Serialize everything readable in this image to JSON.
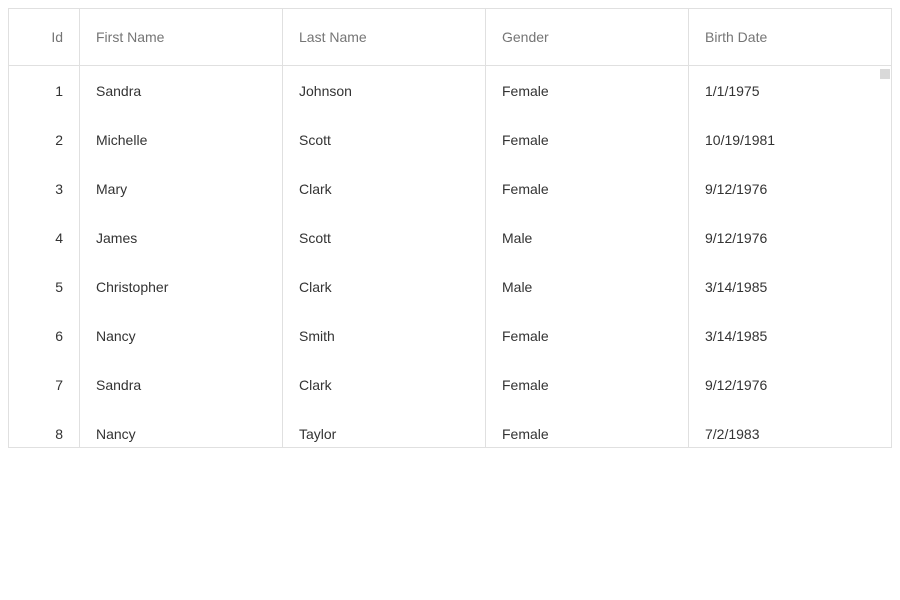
{
  "columns": {
    "id": "Id",
    "first_name": "First Name",
    "last_name": "Last Name",
    "gender": "Gender",
    "birth_date": "Birth Date"
  },
  "rows": [
    {
      "id": "1",
      "first_name": "Sandra",
      "last_name": "Johnson",
      "gender": "Female",
      "birth_date": "1/1/1975"
    },
    {
      "id": "2",
      "first_name": "Michelle",
      "last_name": "Scott",
      "gender": "Female",
      "birth_date": "10/19/1981"
    },
    {
      "id": "3",
      "first_name": "Mary",
      "last_name": "Clark",
      "gender": "Female",
      "birth_date": "9/12/1976"
    },
    {
      "id": "4",
      "first_name": "James",
      "last_name": "Scott",
      "gender": "Male",
      "birth_date": "9/12/1976"
    },
    {
      "id": "5",
      "first_name": "Christopher",
      "last_name": "Clark",
      "gender": "Male",
      "birth_date": "3/14/1985"
    },
    {
      "id": "6",
      "first_name": "Nancy",
      "last_name": "Smith",
      "gender": "Female",
      "birth_date": "3/14/1985"
    },
    {
      "id": "7",
      "first_name": "Sandra",
      "last_name": "Clark",
      "gender": "Female",
      "birth_date": "9/12/1976"
    },
    {
      "id": "8",
      "first_name": "Nancy",
      "last_name": "Taylor",
      "gender": "Female",
      "birth_date": "7/2/1983"
    }
  ]
}
